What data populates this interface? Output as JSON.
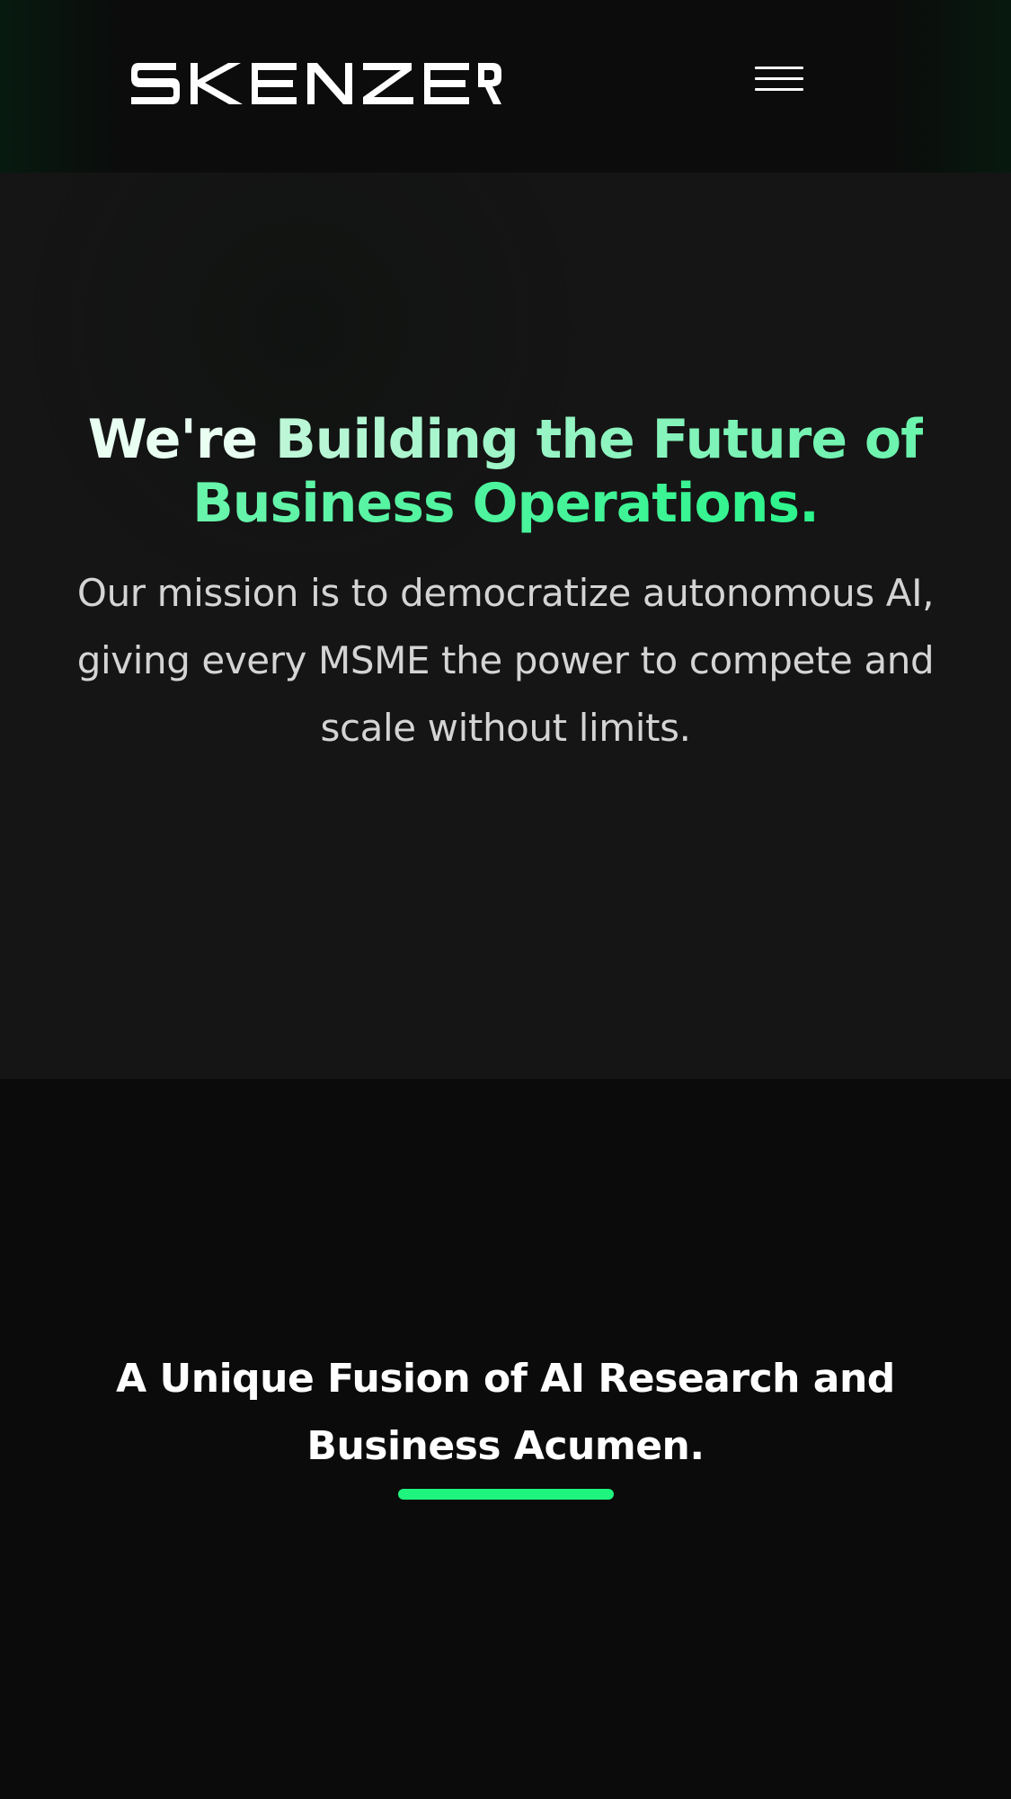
{
  "header": {
    "logo_text": "SKENZER",
    "menu_icon": "hamburger-menu-icon"
  },
  "hero": {
    "title_lead": "We're ",
    "title_accent": "Building the Future of Business Operations.",
    "subtitle": "Our mission is to democratize autonomous AI, giving every MSME the power to compete and scale without limits."
  },
  "fusion": {
    "title": "A Unique Fusion of AI Research and Business Acumen."
  },
  "colors": {
    "background": "#0b0b0b",
    "hero_background": "#151515",
    "accent_green": "#1ff57e",
    "gradient_start": "#bff7d9",
    "text_primary": "#ffffff",
    "text_secondary": "#d4d4d4"
  }
}
